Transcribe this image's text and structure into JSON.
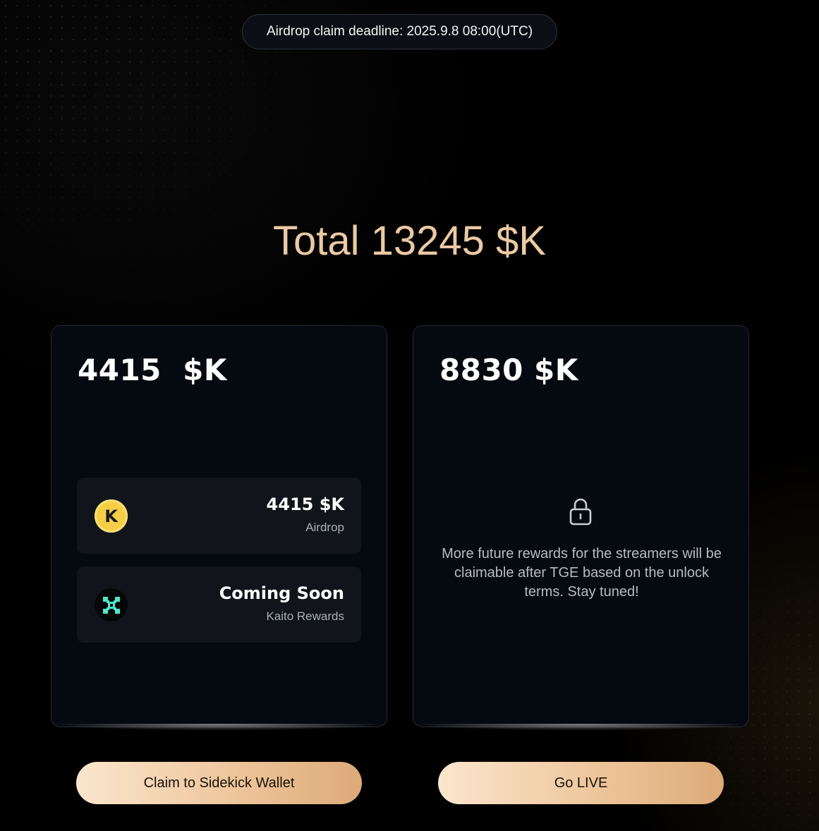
{
  "banner": {
    "deadline_text": "Airdrop claim deadline: 2025.9.8 08:00(UTC)"
  },
  "summary": {
    "total_text": "Total 13245 $K"
  },
  "left_card": {
    "amount_text": "4415  $K",
    "rows": [
      {
        "icon": "kaito-k-coin-icon",
        "title": "4415 $K",
        "subtitle": "Airdrop"
      },
      {
        "icon": "kaito-x-logo-icon",
        "title": "Coming Soon",
        "subtitle": "Kaito Rewards"
      }
    ]
  },
  "right_card": {
    "amount_text": "8830 $K",
    "lock_icon": "lock-icon",
    "locked_message": "More future rewards for the streamers will be claimable after TGE based on the unlock terms. Stay tuned!"
  },
  "buttons": {
    "claim_label": "Claim to Sidekick Wallet",
    "live_label": "Go LIVE"
  },
  "colors": {
    "accent_gold": "#ecc9a4",
    "coin_gold": "#f6cf45",
    "logo_teal": "#4ee8c8",
    "card_bg": "#050910"
  }
}
